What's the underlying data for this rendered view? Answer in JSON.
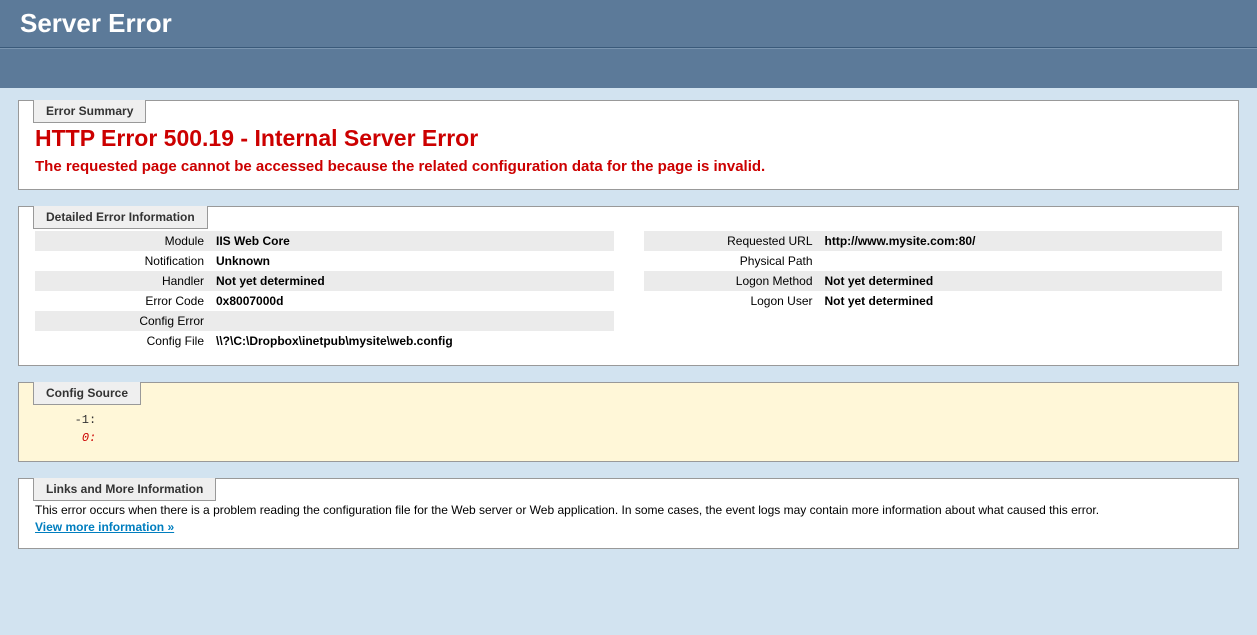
{
  "header": {
    "title": "Server Error"
  },
  "summary": {
    "legend": "Error Summary",
    "title": "HTTP Error 500.19 - Internal Server Error",
    "description": "The requested page cannot be accessed because the related configuration data for the page is invalid."
  },
  "details": {
    "legend": "Detailed Error Information",
    "left": [
      {
        "label": "Module",
        "value": "IIS Web Core"
      },
      {
        "label": "Notification",
        "value": "Unknown"
      },
      {
        "label": "Handler",
        "value": "Not yet determined"
      },
      {
        "label": "Error Code",
        "value": "0x8007000d"
      },
      {
        "label": "Config Error",
        "value": ""
      },
      {
        "label": "Config File",
        "value": "\\\\?\\C:\\Dropbox\\inetpub\\mysite\\web.config"
      }
    ],
    "right": [
      {
        "label": "Requested URL",
        "value": "http://www.mysite.com:80/"
      },
      {
        "label": "Physical Path",
        "value": ""
      },
      {
        "label": "Logon Method",
        "value": "Not yet determined"
      },
      {
        "label": "Logon User",
        "value": "Not yet determined"
      }
    ]
  },
  "configSource": {
    "legend": "Config Source",
    "line_neg": "-1:",
    "line_zero": "0:"
  },
  "links": {
    "legend": "Links and More Information",
    "text": "This error occurs when there is a problem reading the configuration file for the Web server or Web application. In some cases, the event logs may contain more information about what caused this error.",
    "more": "View more information »"
  }
}
